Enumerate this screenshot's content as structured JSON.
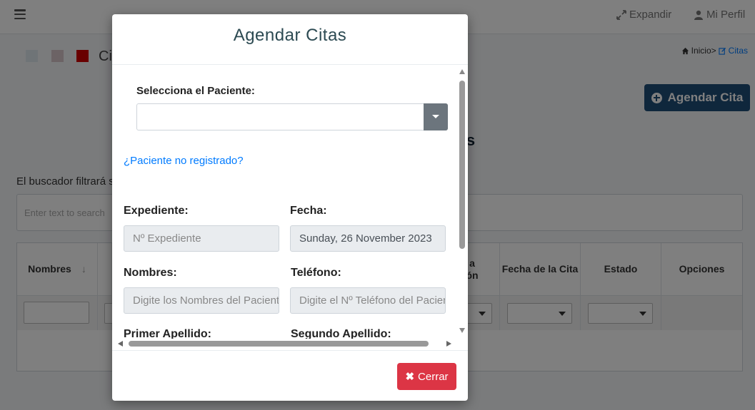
{
  "topbar": {
    "menu_icon": "hamburger-icon",
    "expand_label": "Expandir",
    "profile_label": "Mi Perfil"
  },
  "page": {
    "title": "Ci",
    "breadcrumb_home": "Inicio>",
    "breadcrumb_current": "Citas",
    "agendar_label": "Agendar Cita",
    "section_title_fragment": "adas",
    "filter_note": "El buscador filtrará s",
    "search_placeholder": "Enter text to search"
  },
  "table": {
    "headers": [
      {
        "label": "Nombres"
      },
      {
        "label": ""
      },
      {
        "label": ""
      },
      {
        "label": ""
      },
      {
        "label": ""
      },
      {
        "label": "a ón"
      },
      {
        "label": "Fecha de la Cita"
      },
      {
        "label": "Estado"
      },
      {
        "label": "Opciones"
      }
    ],
    "sort_icon": "↓"
  },
  "modal": {
    "title": "Agendar Citas",
    "patient_label": "Selecciona el Paciente:",
    "patient_value": "",
    "unregistered_link": "¿Paciente no registrado?",
    "expediente_label": "Expediente:",
    "expediente_placeholder": "Nº Expediente",
    "fecha_label": "Fecha:",
    "fecha_value": "Sunday, 26 November 2023",
    "nombres_label": "Nombres:",
    "nombres_placeholder": "Digite los Nombres del Paciente",
    "telefono_label": "Teléfono:",
    "telefono_placeholder": "Digite el Nº Teléfono del Paciente",
    "primer_apellido_label": "Primer Apellido:",
    "segundo_apellido_label": "Segundo Apellido:",
    "close_label": "Cerrar"
  },
  "colors": {
    "primary_dark": "#1f4e79",
    "danger": "#dc3545",
    "link": "#007bff",
    "title": "#2c4a52"
  }
}
